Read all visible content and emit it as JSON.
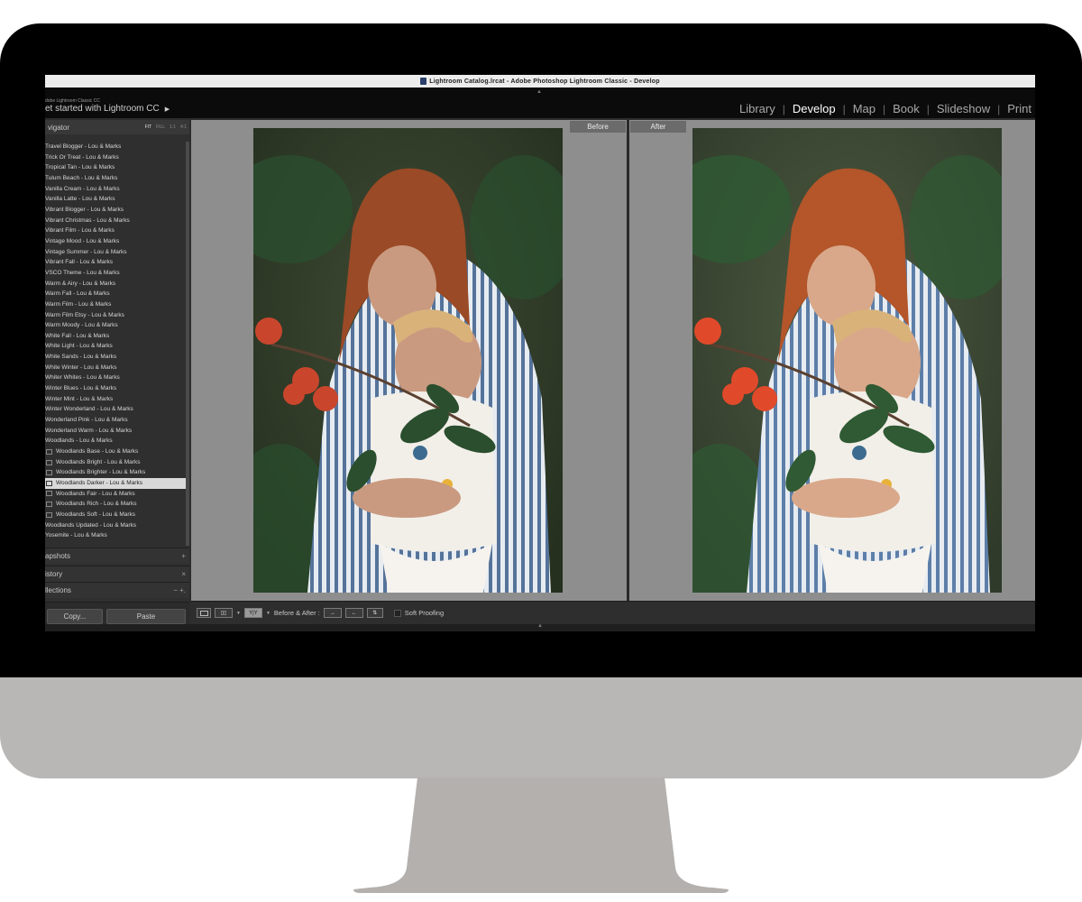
{
  "window": {
    "title": "Lightroom Catalog.lrcat - Adobe Photoshop Lightroom Classic - Develop"
  },
  "identity": {
    "small": "dobe Lightroom Classic CC",
    "big": "et started with Lightroom CC"
  },
  "modules": [
    "Library",
    "Develop",
    "Map",
    "Book",
    "Slideshow",
    "Print"
  ],
  "active_module": "Develop",
  "navigator": {
    "label": "vigator",
    "modes": [
      "FIT",
      "FILL",
      "1:1",
      "4:1"
    ],
    "active_mode": "FIT"
  },
  "presets": [
    {
      "label": "Travel Blogger - Lou & Marks"
    },
    {
      "label": "Trick Or Treat - Lou & Marks"
    },
    {
      "label": "Tropical Tan - Lou & Marks"
    },
    {
      "label": "Tulum Beach - Lou & Marks"
    },
    {
      "label": "Vanilla Cream - Lou & Marks"
    },
    {
      "label": "Vanilla Latte - Lou & Marks"
    },
    {
      "label": "Vibrant Blogger - Lou & Marks"
    },
    {
      "label": "Vibrant Christmas - Lou & Marks"
    },
    {
      "label": "Vibrant Film - Lou & Marks"
    },
    {
      "label": "Vintage Mood - Lou & Marks"
    },
    {
      "label": "Vintage Summer - Lou & Marks"
    },
    {
      "label": "Vibrant Fall - Lou & Marks"
    },
    {
      "label": "VSCO Theme - Lou & Marks"
    },
    {
      "label": "Warm & Airy - Lou & Marks"
    },
    {
      "label": "Warm Fall - Lou & Marks"
    },
    {
      "label": "Warm Film - Lou & Marks"
    },
    {
      "label": "Warm Film Etsy - Lou & Marks"
    },
    {
      "label": "Warm Moody - Lou & Marks"
    },
    {
      "label": "White Fall - Lou & Marks"
    },
    {
      "label": "White Light - Lou & Marks"
    },
    {
      "label": "White Sands - Lou & Marks"
    },
    {
      "label": "White Winter - Lou & Marks"
    },
    {
      "label": "Whiter Whites - Lou & Marks"
    },
    {
      "label": "Winter Blues - Lou & Marks"
    },
    {
      "label": "Winter Mint - Lou & Marks"
    },
    {
      "label": "Winter Wonderland - Lou & Marks"
    },
    {
      "label": "Wonderland Pink - Lou & Marks"
    },
    {
      "label": "Wonderland Warm - Lou & Marks"
    },
    {
      "label": "Woodlands - Lou & Marks"
    },
    {
      "label": "Woodlands Base - Lou & Marks",
      "sub": true
    },
    {
      "label": "Woodlands Bright - Lou & Marks",
      "sub": true
    },
    {
      "label": "Woodlands Brighter - Lou & Marks",
      "sub": true
    },
    {
      "label": "Woodlands Darker - Lou & Marks",
      "sub": true,
      "selected": true
    },
    {
      "label": "Woodlands Fair - Lou & Marks",
      "sub": true
    },
    {
      "label": "Woodlands Rich - Lou & Marks",
      "sub": true
    },
    {
      "label": "Woodlands Soft - Lou & Marks",
      "sub": true
    },
    {
      "label": "Woodlands Updated - Lou & Marks"
    },
    {
      "label": "Yosemite - Lou & Marks"
    }
  ],
  "panels": {
    "snapshots": {
      "label": "apshots",
      "control": "+"
    },
    "history": {
      "label": "istory",
      "control": "×"
    },
    "collections": {
      "label": "llections",
      "control": "−  +."
    }
  },
  "buttons": {
    "copy": "Copy...",
    "paste": "Paste"
  },
  "view": {
    "before_label": "Before",
    "after_label": "After"
  },
  "toolbar": {
    "before_after_label": "Before & After :",
    "soft_proofing_label": "Soft Proofing",
    "yy_label": "Y|Y"
  },
  "colors": {
    "accent_active": "#ffffff",
    "panel_bg": "#2f2f2f",
    "selected_row": "#d9d9d9"
  }
}
